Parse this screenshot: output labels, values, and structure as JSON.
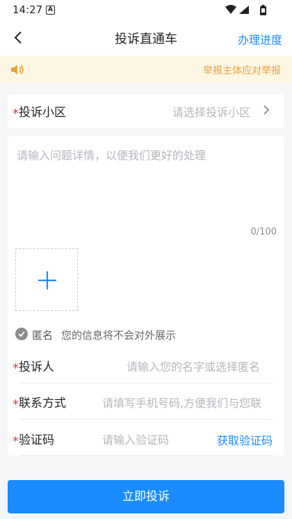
{
  "status_bar": {
    "time": "14:27",
    "notification_icon": "A"
  },
  "header": {
    "title": "投诉直通车",
    "progress_link": "办理进度",
    "back_icon": "chevron-left-icon"
  },
  "notice": {
    "text": "举报主体应对举报",
    "icon": "speaker-icon",
    "color": "#e6a23c"
  },
  "form": {
    "community": {
      "required_mark": "*",
      "label": "投诉小区",
      "placeholder": "请选择投诉小区"
    },
    "details": {
      "placeholder": "请输入问题详情，以便我们更好的处理",
      "counter": "0/100"
    },
    "upload": {
      "icon": "plus-icon"
    },
    "anonymous": {
      "label": "匿名",
      "hint": "您的信息将不会对外展示"
    },
    "complainant": {
      "required_mark": "*",
      "label": "投诉人",
      "placeholder": "请输入您的名字或选择匿名"
    },
    "contact": {
      "required_mark": "*",
      "label": "联系方式",
      "placeholder": "请填写手机号码,方便我们与您联"
    },
    "code": {
      "required_mark": "*",
      "label": "验证码",
      "placeholder": "请输入验证码",
      "button": "获取验证码"
    }
  },
  "submit": {
    "label": "立即投诉"
  },
  "colors": {
    "accent": "#1a8cff",
    "required": "#e03a3a",
    "notice_bg": "#fdf6e5"
  }
}
